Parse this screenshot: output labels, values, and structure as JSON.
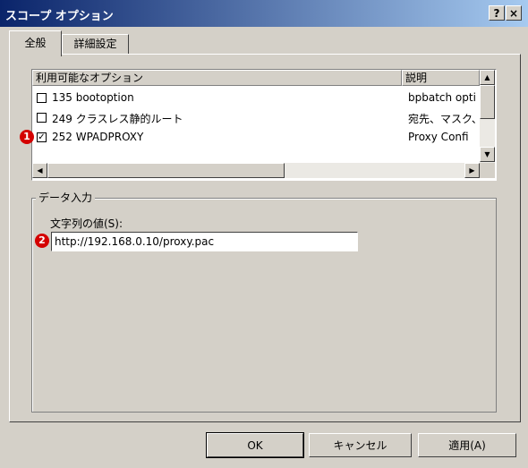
{
  "window": {
    "title": "スコープ オプション",
    "help_label": "?",
    "close_label": "×"
  },
  "tabs": [
    {
      "label": "全般",
      "active": true
    },
    {
      "label": "詳細設定",
      "active": false
    }
  ],
  "options_list": {
    "col_name": "利用可能なオプション",
    "col_desc": "説明",
    "rows": [
      {
        "checked": false,
        "name": "135 bootoption",
        "desc": "bpbatch opti"
      },
      {
        "checked": false,
        "name": "249 クラスレス静的ルート",
        "desc": "宛先、マスク、"
      },
      {
        "checked": true,
        "name": "252 WPADPROXY",
        "desc": "Proxy Confi"
      }
    ],
    "scroll_up": "▲",
    "scroll_down": "▼",
    "scroll_left": "◀",
    "scroll_right": "▶",
    "check_mark": "✓"
  },
  "data_entry": {
    "group_label": "データ入力",
    "field_label": "文字列の値(S):",
    "value": "http://192.168.0.10/proxy.pac"
  },
  "annotations": {
    "badge1": "1",
    "badge2": "2",
    "color": "#d40000"
  },
  "buttons": {
    "ok": "OK",
    "cancel": "キャンセル",
    "apply": "適用(A)"
  }
}
